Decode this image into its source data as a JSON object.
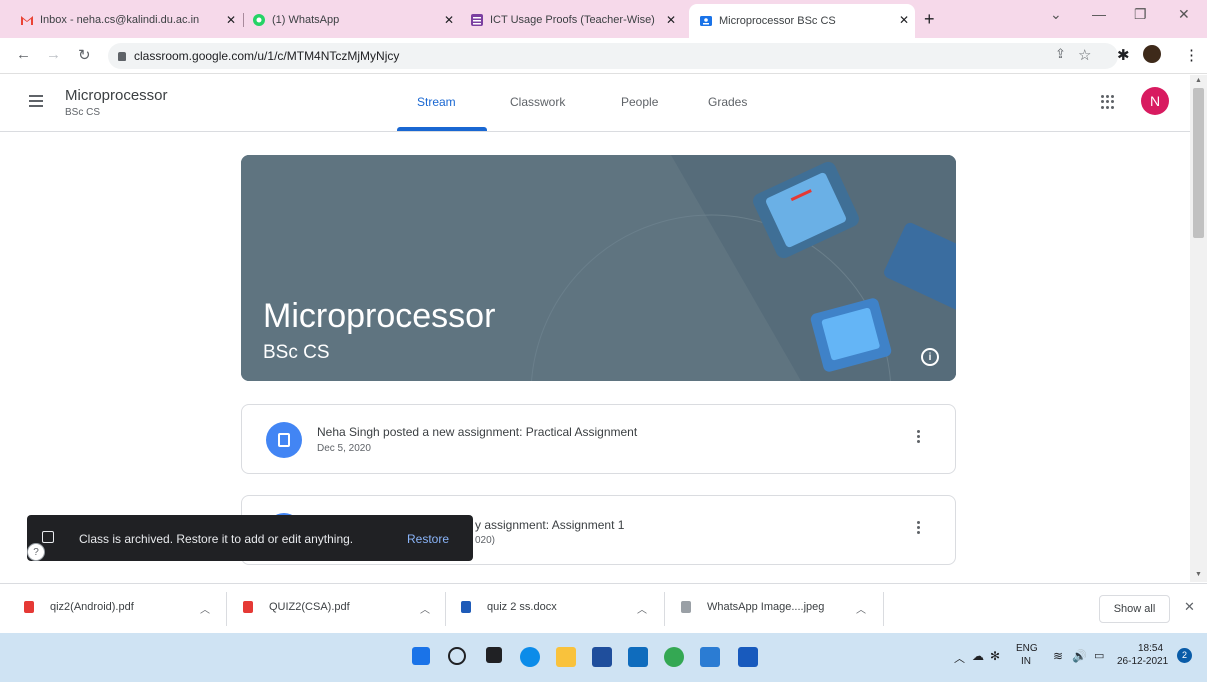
{
  "browser": {
    "tabs": [
      {
        "label": "Inbox - neha.cs@kalindi.du.ac.in",
        "favicon": "gmail-icon"
      },
      {
        "label": "(1) WhatsApp",
        "favicon": "whatsapp-icon"
      },
      {
        "label": "ICT Usage Proofs (Teacher-Wise)",
        "favicon": "sheets-icon"
      },
      {
        "label": "Microprocessor BSc CS",
        "favicon": "classroom-icon"
      }
    ],
    "url": "classroom.google.com/u/1/c/MTM4NTczMjMyNjcy"
  },
  "classroom": {
    "title": "Microprocessor",
    "subtitle": "BSc CS",
    "nav": [
      "Stream",
      "Classwork",
      "People",
      "Grades"
    ],
    "avatar_letter": "N",
    "banner": {
      "title": "Microprocessor",
      "subtitle": "BSc CS"
    },
    "posts": [
      {
        "title": "Neha Singh posted a new assignment: Practical Assignment",
        "date": "Dec 5, 2020"
      },
      {
        "title_visible": "y assignment: Assignment 1",
        "date_visible": "020)"
      }
    ]
  },
  "snackbar": {
    "text": "Class is archived. Restore it to add or edit anything.",
    "action": "Restore"
  },
  "downloads": {
    "items": [
      "qiz2(Android).pdf",
      "QUIZ2(CSA).pdf",
      "quiz 2 ss.docx",
      "WhatsApp Image....jpeg"
    ],
    "show_all": "Show all"
  },
  "taskbar": {
    "language": "ENG",
    "region": "IN",
    "time": "18:54",
    "date": "26-12-2021",
    "notification_count": "2"
  },
  "colors": {
    "accent": "#1967d2",
    "banner": "#5f7480",
    "avatar": "#d81b60",
    "tabstrip": "#f6d9ea"
  }
}
